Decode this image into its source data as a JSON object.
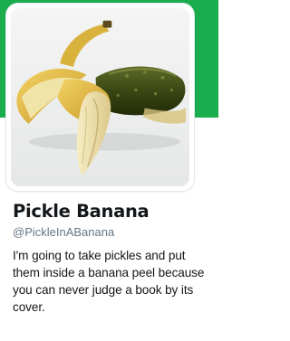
{
  "colors": {
    "cover": "#19ad4e",
    "name_text": "#14171a",
    "handle_text": "#657786",
    "bio_text": "#14171a"
  },
  "profile": {
    "display_name": "Pickle Banana",
    "handle": "@PickleInABanana",
    "bio": "I'm going to take pickles and put them inside a banana peel because you can never judge a book by its cover.",
    "avatar_subject": "pickle-inside-banana-peel"
  }
}
